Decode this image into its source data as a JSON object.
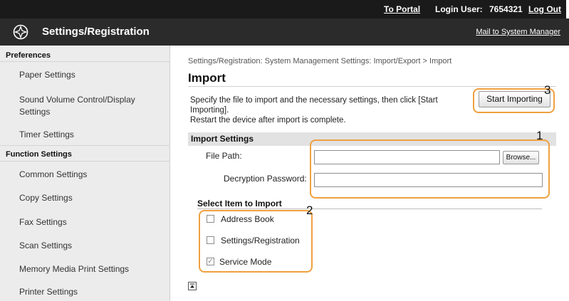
{
  "topbar": {
    "portal_link": "To Portal",
    "login_label": "Login User:",
    "login_user": "7654321",
    "logout": "Log Out"
  },
  "header": {
    "title": "Settings/Registration",
    "mail_link": "Mail to System Manager",
    "logo_icon": "settings-registration-icon"
  },
  "sidebar": {
    "preferences_heading": "Preferences",
    "preferences_items": [
      {
        "label": "Paper Settings"
      },
      {
        "label": "Sound Volume Control/Display Settings"
      },
      {
        "label": "Timer Settings"
      }
    ],
    "function_heading": "Function Settings",
    "function_items": [
      {
        "label": "Common Settings"
      },
      {
        "label": "Copy Settings"
      },
      {
        "label": "Fax Settings"
      },
      {
        "label": "Scan Settings"
      },
      {
        "label": "Memory Media Print Settings"
      },
      {
        "label": "Printer Settings"
      }
    ]
  },
  "main": {
    "breadcrumb": "Settings/Registration: System Management Settings: Import/Export > Import",
    "title": "Import",
    "description_1": "Specify the file to import and the necessary settings, then click [Start Importing].",
    "description_2": "Restart the device after import is complete.",
    "start_button": "Start Importing",
    "import_settings": {
      "heading": "Import Settings",
      "file_path_label": "File Path:",
      "file_path_value": "",
      "browse_button": "Browse...",
      "password_label": "Decryption Password:",
      "password_value": ""
    },
    "select_items": {
      "heading": "Select Item to Import",
      "items": [
        {
          "label": "Address Book",
          "checked": false
        },
        {
          "label": "Settings/Registration",
          "checked": false
        },
        {
          "label": "Service Mode",
          "checked": true
        }
      ]
    },
    "scroll_top_icon": "scroll-to-top-icon"
  },
  "callouts": [
    "1",
    "2",
    "3"
  ],
  "colors": {
    "callout": "#f0a040",
    "topbar": "#1a1a1a",
    "header": "#2b2b2b",
    "sidebar": "#ececec"
  }
}
